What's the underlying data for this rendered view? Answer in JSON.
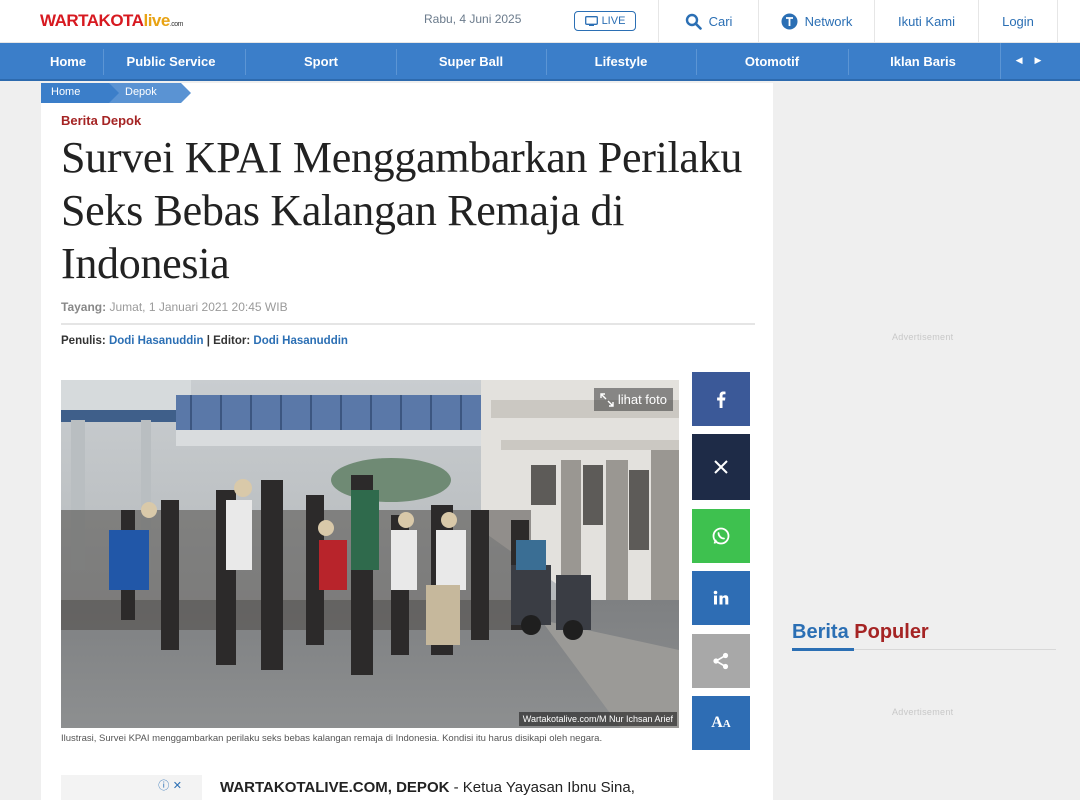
{
  "header": {
    "logo_main": "WARTAKOTA",
    "logo_live": "live",
    "logo_com": ".com",
    "date": "Rabu, 4 Juni 2025",
    "live_label": "LIVE",
    "search_label": "Cari",
    "network_label": "Network",
    "follow_label": "Ikuti Kami",
    "login_label": "Login"
  },
  "nav": {
    "items": [
      "Home",
      "Public Service",
      "Sport",
      "Super Ball",
      "Lifestyle",
      "Otomotif",
      "Iklan Baris"
    ]
  },
  "breadcrumb": [
    "Home",
    "Depok"
  ],
  "article": {
    "kanal": "Berita Depok",
    "title": "Survei KPAI Menggambarkan Perilaku Seks Bebas Kalangan Remaja di Indonesia",
    "tayang_label": "Tayang:",
    "tayang_value": "Jumat, 1 Januari 2021 20:45 WIB",
    "penulis_label": "Penulis:",
    "penulis": "Dodi Hasanuddin",
    "separator": "|",
    "editor_label": "Editor:",
    "editor": "Dodi Hasanuddin",
    "lihat_foto": "lihat foto",
    "photo_credit": "Wartakotalive.com/M Nur Ichsan Arief",
    "caption": "Ilustrasi, Survei KPAI menggambarkan perilaku seks bebas kalangan remaja di Indonesia. Kondisi itu harus disikapi oleh negara.",
    "lead_source": "WARTAKOTALIVE.COM, DEPOK",
    "lead_text": " - Ketua Yayasan Ibnu Sina,"
  },
  "share": {
    "colors": {
      "facebook": "#3b5998",
      "x": "#1e2b47",
      "whatsapp": "#3ec14f",
      "linkedin": "#2e6db4",
      "share": "#a8a8a8",
      "font": "#2e6db4"
    },
    "font_label": "A"
  },
  "sidebar": {
    "ad_label_1": "Advertisement",
    "ad_label_2": "Advertisement",
    "popular_a": "Berita",
    "popular_b": "Populer"
  },
  "colors": {
    "brand_red": "#d71920",
    "nav_blue": "#3b7ec9",
    "link_blue": "#2b6fb4",
    "kanal_red": "#a52424"
  }
}
